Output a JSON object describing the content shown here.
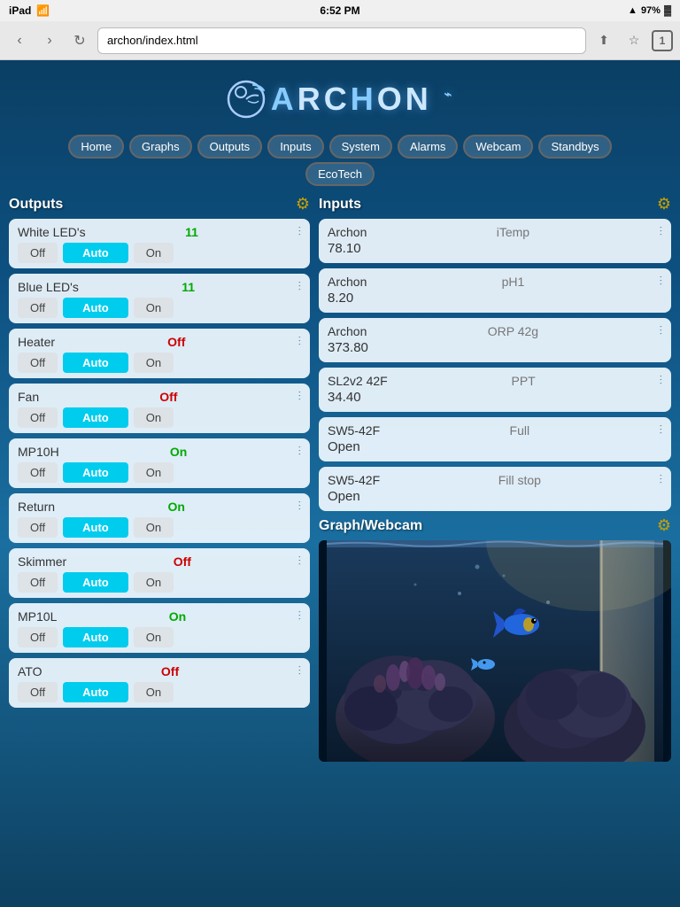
{
  "statusBar": {
    "device": "iPad",
    "wifi": "WiFi",
    "time": "6:52 PM",
    "signal": "▲",
    "battery": "97%",
    "tabCount": "1"
  },
  "browser": {
    "url": "archon/index.html",
    "backLabel": "‹",
    "forwardLabel": "›",
    "refreshLabel": "↻",
    "shareLabel": "⬆",
    "bookmarkLabel": "☆"
  },
  "logo": {
    "text": "ARCHON"
  },
  "nav": {
    "items": [
      "Home",
      "Graphs",
      "Outputs",
      "Inputs",
      "System",
      "Alarms",
      "Webcam",
      "Standbys"
    ],
    "items2": [
      "EcoTech"
    ]
  },
  "outputs": {
    "title": "Outputs",
    "items": [
      {
        "name": "White LED's",
        "status": "11",
        "statusType": "green",
        "buttons": [
          "Off",
          "Auto",
          "On"
        ]
      },
      {
        "name": "Blue LED's",
        "status": "11",
        "statusType": "green",
        "buttons": [
          "Off",
          "Auto",
          "On"
        ]
      },
      {
        "name": "Heater",
        "status": "Off",
        "statusType": "red",
        "buttons": [
          "Off",
          "Auto",
          "On"
        ]
      },
      {
        "name": "Fan",
        "status": "Off",
        "statusType": "red",
        "buttons": [
          "Off",
          "Auto",
          "On"
        ]
      },
      {
        "name": "MP10H",
        "status": "On",
        "statusType": "green",
        "buttons": [
          "Off",
          "Auto",
          "On"
        ]
      },
      {
        "name": "Return",
        "status": "On",
        "statusType": "green",
        "buttons": [
          "Off",
          "Auto",
          "On"
        ]
      },
      {
        "name": "Skimmer",
        "status": "Off",
        "statusType": "red",
        "buttons": [
          "Off",
          "Auto",
          "On"
        ]
      },
      {
        "name": "MP10L",
        "status": "On",
        "statusType": "green",
        "buttons": [
          "Off",
          "Auto",
          "On"
        ]
      },
      {
        "name": "ATO",
        "status": "Off",
        "statusType": "red",
        "buttons": [
          "Off",
          "Auto",
          "On"
        ]
      }
    ]
  },
  "inputs": {
    "title": "Inputs",
    "items": [
      {
        "source": "Archon",
        "name": "iTemp",
        "value": "78.10"
      },
      {
        "source": "Archon",
        "name": "pH1",
        "value": "8.20"
      },
      {
        "source": "Archon",
        "name": "ORP 42g",
        "value": "373.80"
      },
      {
        "source": "SL2v2 42F",
        "name": "PPT",
        "value": "34.40"
      },
      {
        "source": "SW5-42F",
        "name": "Full",
        "value": "Open"
      },
      {
        "source": "SW5-42F",
        "name": "Fill stop",
        "value": "Open"
      }
    ]
  },
  "graphWebcam": {
    "title": "Graph/Webcam"
  }
}
